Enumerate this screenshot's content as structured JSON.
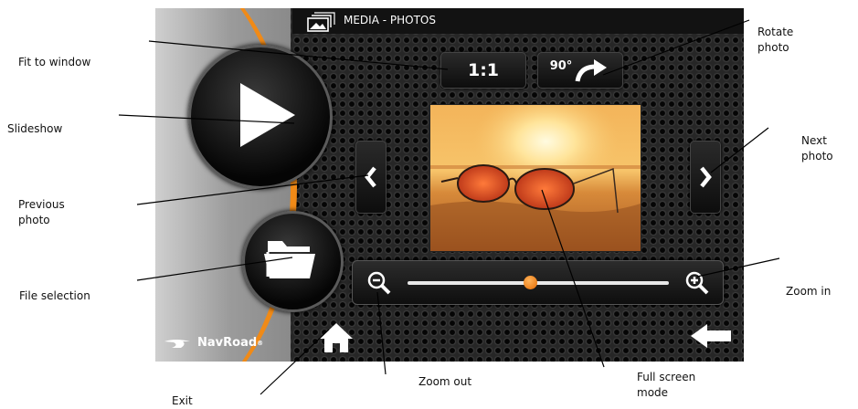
{
  "callouts": {
    "fit_to_window": "Fit to window",
    "slideshow": "Slideshow",
    "previous_photo": "Previous photo",
    "file_selection": "File selection",
    "exit": "Exit",
    "zoom_out": "Zoom out",
    "full_screen_mode": "Full screen mode",
    "zoom_in": "Zoom in",
    "next_photo": "Next photo",
    "rotate_photo": "Rotate photo"
  },
  "screen": {
    "title": "MEDIA - PHOTOS",
    "fit_button_label": "1:1",
    "rotate_button_label": "90°",
    "logo_text": "NavRoad",
    "logo_mark": "®",
    "zoom_level": 0.47
  },
  "icons": {
    "title": "gallery-icon",
    "slideshow": "play-icon",
    "files": "folder-icon",
    "prev": "chevron-left-icon",
    "next": "chevron-right-icon",
    "zoom_out": "zoom-out-icon",
    "zoom_in": "zoom-in-icon",
    "home": "home-icon",
    "back": "back-arrow-icon",
    "rotate": "rotate-arrow-icon"
  },
  "colors": {
    "accent": "#f08a17",
    "bar": "#121212",
    "text": "#ffffff"
  }
}
